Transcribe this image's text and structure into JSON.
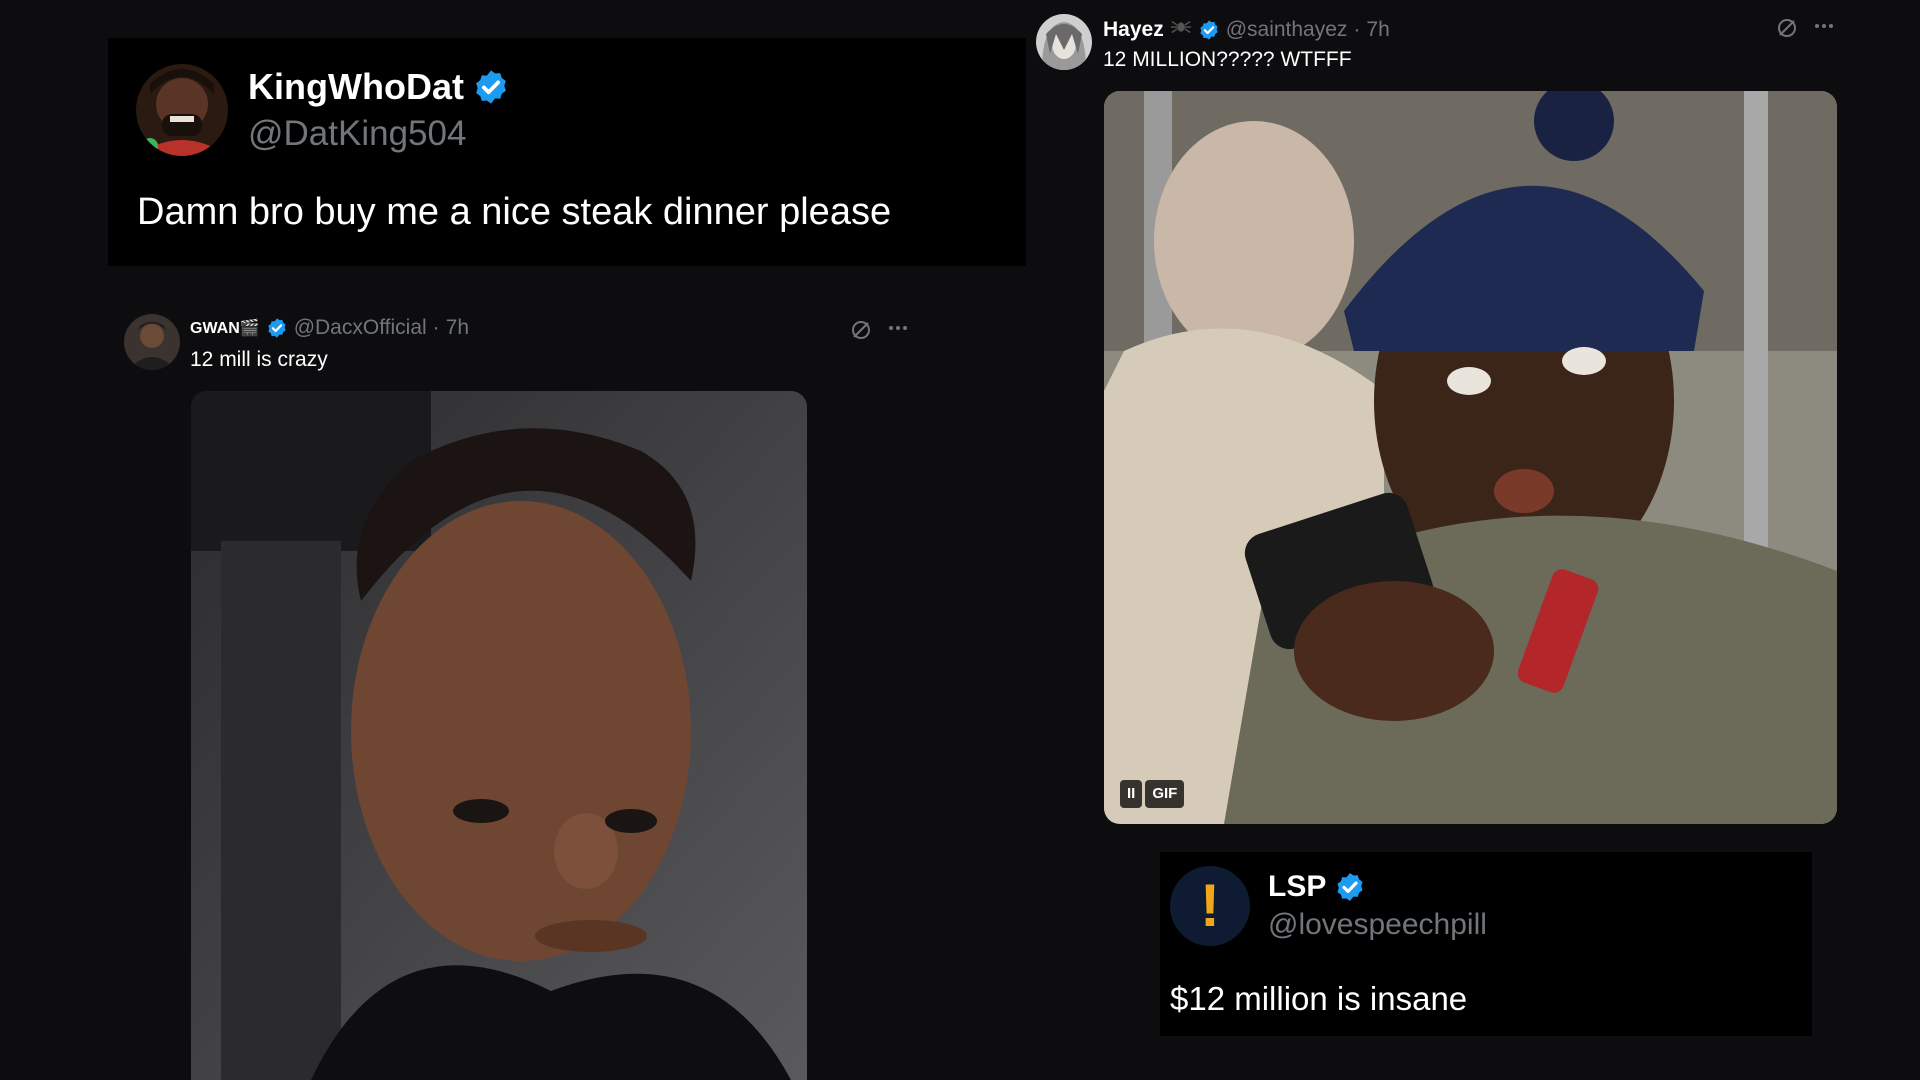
{
  "colors": {
    "background": "#0d0d0f",
    "card": "#000000",
    "verified": "#1d9bf0",
    "muted": "#71767b"
  },
  "quote_card_1": {
    "display_name": "KingWhoDat",
    "handle": "@DatKing504",
    "text": "Damn bro buy me a nice steak dinner please"
  },
  "reply_gwan": {
    "display_name": "GWAN🎬",
    "handle": "@DacxOfficial",
    "separator": "·",
    "time": "7h",
    "text": "12 mill is crazy",
    "media": {
      "icon": "photo-child"
    }
  },
  "reply_hayez": {
    "display_name": "Hayez",
    "handle": "@sainthayez",
    "separator": "·",
    "time": "7h",
    "text": "12 MILLION????? WTFFF",
    "media": {
      "icon": "gif-man-phone",
      "gif_label": "GIF",
      "pause_label": "II"
    }
  },
  "quote_card_lsp": {
    "display_name": "LSP",
    "handle": "@lovespeechpill",
    "text": "$12 million is insane",
    "avatar_glyph": "!"
  }
}
